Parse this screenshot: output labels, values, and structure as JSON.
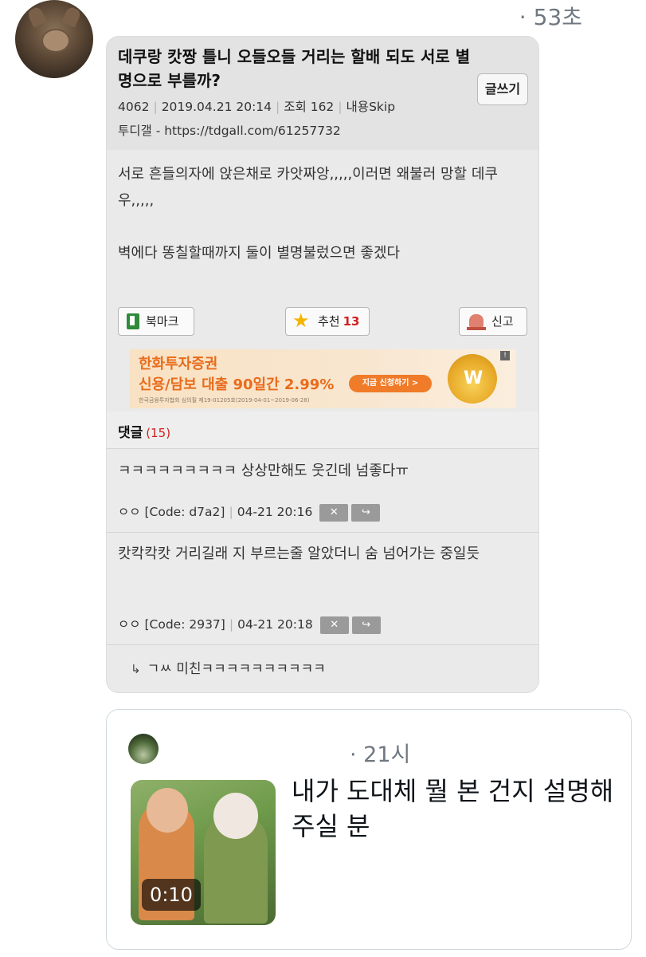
{
  "tweet": {
    "time": "· 53초",
    "post": {
      "title": "데쿠랑 캇짱 틀니 오들오들 거리는 할배 되도 서로 별명으로 부를까?",
      "write_button": "글쓰기",
      "meta": {
        "post_no": "4062",
        "datetime": "2019.04.21 20:14",
        "views": "조회 162",
        "content": "내용Skip"
      },
      "source": "투디갤 - https://tdgall.com/61257732",
      "body": [
        "서로 흔들의자에 앉은채로 카앗짜앙,,,,,이러면 왜불러 망할 데쿠우,,,,,",
        "벽에다 똥칠할때까지 둘이 별명불렀으면 좋겠다"
      ],
      "actions": {
        "bookmark": "북마크",
        "recommend": "추천",
        "recommend_count": "13",
        "report": "신고"
      },
      "ad": {
        "brand": "한화투자증권",
        "headline": "신용/담보 대출 90일간 2.99%",
        "cta": "지금 신청하기 >",
        "fine_print": "한국금융투자협회 심의필 제19-01205호(2019-04-01~2019-06-28)",
        "badge": "W"
      },
      "comments_header": {
        "label": "댓글",
        "count": "(15)"
      },
      "comments": [
        {
          "text": "ㅋㅋㅋㅋㅋㅋㅋㅋㅋ 상상만해도 웃긴데 넘좋다ㅠ",
          "author": "ㅇㅇ",
          "code": "[Code: d7a2]",
          "time": "04-21 20:16"
        },
        {
          "text": "캇칵칵캇 거리길래 지 부르는줄 알았더니 숨 넘어가는 중일듯",
          "author": "ㅇㅇ",
          "code": "[Code: 2937]",
          "time": "04-21 20:18"
        }
      ],
      "reply": "ㄱㅆ 미친ㅋㅋㅋㅋㅋㅋㅋㅋㅋㅋ"
    }
  },
  "quote": {
    "time": "· 21시",
    "video_duration": "0:10",
    "text": "내가 도대체 뭘 본 건지 설명해 주실 분"
  }
}
